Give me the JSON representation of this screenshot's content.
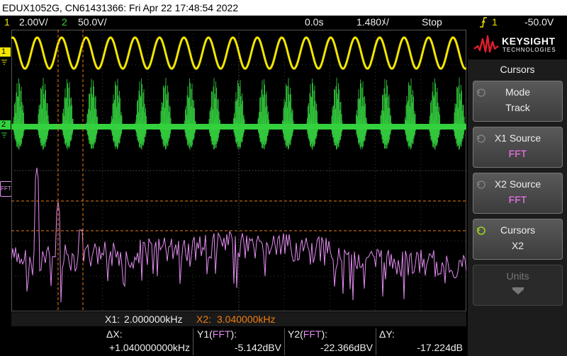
{
  "title_bar": {
    "text": "EDUX1052G, CN61431366: Fri Apr 22 17:48:54 2022"
  },
  "status_bar": {
    "ch1_number": "1",
    "ch1_scale": "2.00V/",
    "ch2_number": "2",
    "ch2_scale": "50.0V/",
    "time_delay": "0.0s",
    "time_scale": "1.480ﾒ/",
    "run_state": "Stop",
    "trigger_icon": "trigger-rising-edge-icon",
    "trigger_source": "1",
    "trigger_level": "-50.0V"
  },
  "markers": {
    "ch1": "1",
    "ch2": "2",
    "fft": "FFT"
  },
  "panel": {
    "brand": "KEYSIGHT",
    "brand_sub": "TECHNOLOGIES",
    "menu_title": "Cursors",
    "softkeys": [
      {
        "label": "Mode",
        "value": "Track"
      },
      {
        "label": "X1 Source",
        "value": "FFT"
      },
      {
        "label": "X2 Source",
        "value": "FFT"
      },
      {
        "label": "Cursors",
        "value": "X2"
      },
      {
        "label": "Units",
        "value": ""
      }
    ]
  },
  "cursor_bar": {
    "x1_label": "X1:",
    "x1_value": "2.000000kHz",
    "x2_label": "X2:",
    "x2_value": "3.040000kHz"
  },
  "readout": {
    "dx_label": "ΔX:",
    "dx_value": "+1.040000000kHz",
    "y1_label": "Y1",
    "y1_src": "FFT",
    "y1_colon": "):",
    "y1_value": "-5.142dBV",
    "y2_label": "Y2",
    "y2_src": "FFT",
    "y2_colon": "):",
    "y2_value": "-22.366dBV",
    "dy_label": "ΔY:",
    "dy_value": "-17.224dB"
  },
  "colors": {
    "ch1": "#f2e600",
    "ch2": "#34d13f",
    "fft": "#e38cf0",
    "cursor": "#f07d12",
    "softkey_active_value": "#ff77ff",
    "cursors_icon": "#9fd420"
  }
}
